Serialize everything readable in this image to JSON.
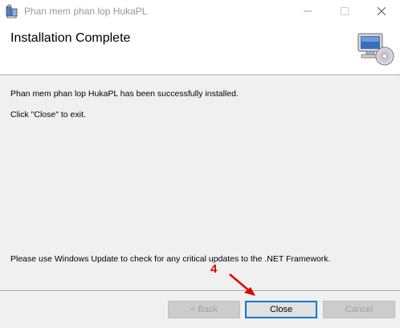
{
  "window": {
    "title": "Phan mem phan lop HukaPL"
  },
  "banner": {
    "title": "Installation Complete"
  },
  "content": {
    "message_installed": "Phan mem phan lop HukaPL has been successfully installed.",
    "message_exit": "Click \"Close\" to exit.",
    "message_update": "Please use Windows Update to check for any critical updates to the .NET Framework."
  },
  "footer": {
    "back_label": "< Back",
    "close_label": "Close",
    "cancel_label": "Cancel"
  },
  "annotation": {
    "step_number": "4"
  },
  "colors": {
    "annotation": "#e00000",
    "focus_border": "#0078d7"
  }
}
